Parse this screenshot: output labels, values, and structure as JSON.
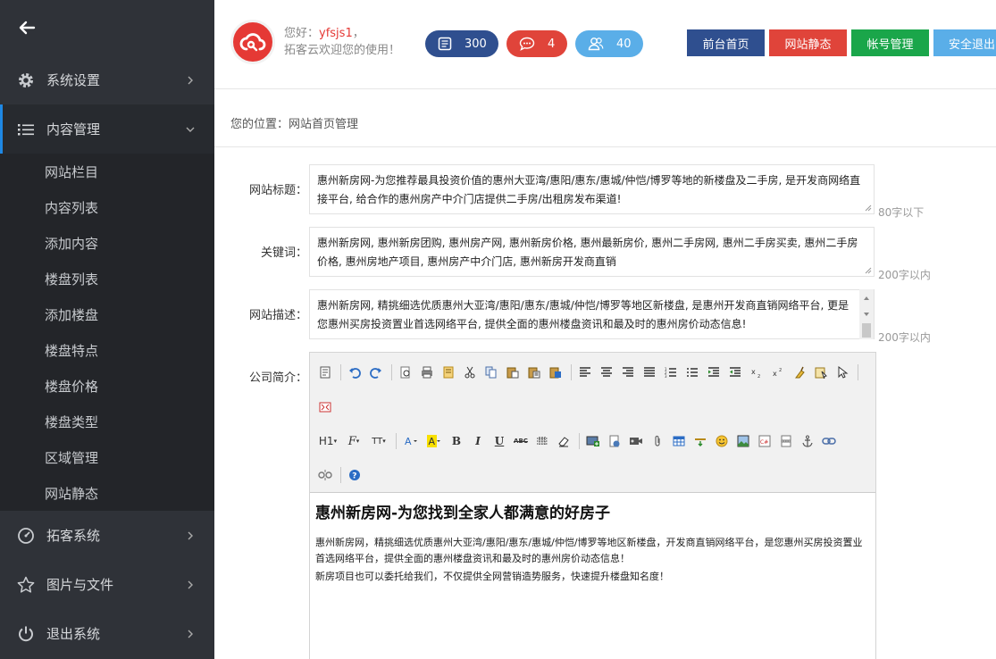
{
  "sidebar": {
    "items": [
      {
        "label": "系统设置",
        "icon": "gear-icon"
      },
      {
        "label": "内容管理",
        "icon": "list-icon"
      },
      {
        "label": "拓客系统",
        "icon": "dashboard-icon"
      },
      {
        "label": "图片与文件",
        "icon": "star-icon"
      },
      {
        "label": "退出系统",
        "icon": "power-icon"
      }
    ],
    "submenu": [
      "网站栏目",
      "内容列表",
      "添加内容",
      "楼盘列表",
      "添加楼盘",
      "楼盘特点",
      "楼盘价格",
      "楼盘类型",
      "区域管理",
      "网站静态"
    ]
  },
  "header": {
    "greeting_prefix": "您好：",
    "username": "yfsjs1",
    "greeting_suffix": "，",
    "welcome": "拓客云欢迎您的使用！",
    "stats": [
      {
        "value": "300",
        "icon": "document-icon",
        "color": "#2f4f8f"
      },
      {
        "value": "4",
        "icon": "chat-icon",
        "color": "#e0443a"
      },
      {
        "value": "40",
        "icon": "users-icon",
        "color": "#5aaee8"
      }
    ],
    "buttons": [
      {
        "label": "前台首页",
        "color": "#2f4f8f"
      },
      {
        "label": "网站静态",
        "color": "#e0443a"
      },
      {
        "label": "帐号管理",
        "color": "#1aa64a"
      },
      {
        "label": "安全退出",
        "color": "#5aaee8"
      }
    ]
  },
  "breadcrumb": "您的位置：网站首页管理",
  "form": {
    "title_label": "网站标题：",
    "title_value": "惠州新房网-为您推荐最具投资价值的惠州大亚湾/惠阳/惠东/惠城/仲恺/博罗等地的新楼盘及二手房, 是开发商网络直接平台, 给合作的惠州房产中介门店提供二手房/出租房发布渠道!",
    "title_hint": "80字以下",
    "keywords_label": "关键词：",
    "keywords_value": "惠州新房网, 惠州新房团购, 惠州房产网, 惠州新房价格, 惠州最新房价, 惠州二手房网, 惠州二手房买卖, 惠州二手房价格, 惠州房地产项目, 惠州房产中介门店, 惠州新房开发商直销",
    "keywords_hint": "200字以内",
    "desc_label": "网站描述：",
    "desc_value": "惠州新房网, 精挑细选优质惠州大亚湾/惠阳/惠东/惠城/仲恺/博罗等地区新楼盘, 是惠州开发商直销网络平台, 更是您惠州买房投资置业首选网络平台, 提供全面的惠州楼盘资讯和最及时的惠州房价动态信息!",
    "desc_hint": "200字以内",
    "intro_label": "公司简介："
  },
  "editor": {
    "toolbar_text": {
      "h1": "H1",
      "font": "F",
      "size": "TT",
      "bold": "B",
      "italic": "I",
      "underline": "U",
      "strike": "ABC"
    },
    "heading": "惠州新房网-为您找到全家人都满意的好房子",
    "paragraphs": [
      "惠州新房网，精挑细选优质惠州大亚湾/惠阳/惠东/惠城/仲恺/博罗等地区新楼盘，开发商直销网络平台，是您惠州买房投资置业首选网络平台，提供全面的惠州楼盘资讯和最及时的惠州房价动态信息！",
      "新房项目也可以委托给我们，不仅提供全网营销造势服务，快速提升楼盘知名度！"
    ]
  }
}
